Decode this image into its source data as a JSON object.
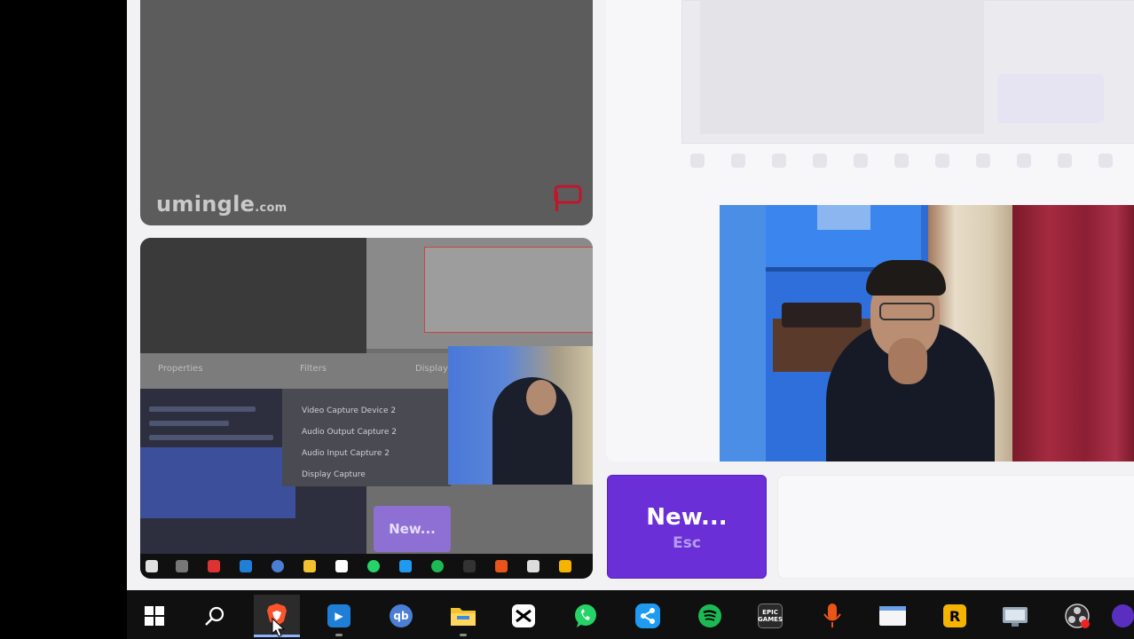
{
  "stranger_video": {
    "brand_main": "umingle",
    "brand_suffix": ".com"
  },
  "main_buttons": {
    "new_label": "New...",
    "new_hint": "Esc"
  },
  "nested_capture": {
    "new_label": "New...",
    "tab_labels": [
      "Properties",
      "Filters",
      "Display"
    ],
    "source_labels": [
      "Video Capture Device 2",
      "Audio Output Capture 2",
      "Audio Input Capture 2",
      "Display Capture"
    ]
  },
  "taskbar": {
    "items": [
      {
        "name": "windows-start-icon",
        "label": "Start"
      },
      {
        "name": "search-icon",
        "label": "Search"
      },
      {
        "name": "brave-browser-icon",
        "label": "Brave"
      },
      {
        "name": "app-icon-blue",
        "label": ""
      },
      {
        "name": "qbittorrent-icon",
        "label": "qb"
      },
      {
        "name": "file-explorer-icon",
        "label": ""
      },
      {
        "name": "capcut-icon",
        "label": ""
      },
      {
        "name": "whatsapp-icon",
        "label": ""
      },
      {
        "name": "shareit-icon",
        "label": ""
      },
      {
        "name": "spotify-icon",
        "label": ""
      },
      {
        "name": "epic-games-icon",
        "label": "EPIC GAMES"
      },
      {
        "name": "microphone-app-icon",
        "label": ""
      },
      {
        "name": "window-app-icon",
        "label": ""
      },
      {
        "name": "rockstar-icon",
        "label": "R"
      },
      {
        "name": "network-app-icon",
        "label": ""
      },
      {
        "name": "obs-icon",
        "label": ""
      }
    ]
  },
  "colors": {
    "accent": "#6a2fd6",
    "taskbar": "#101010",
    "app_background": "#f2f2f4"
  }
}
